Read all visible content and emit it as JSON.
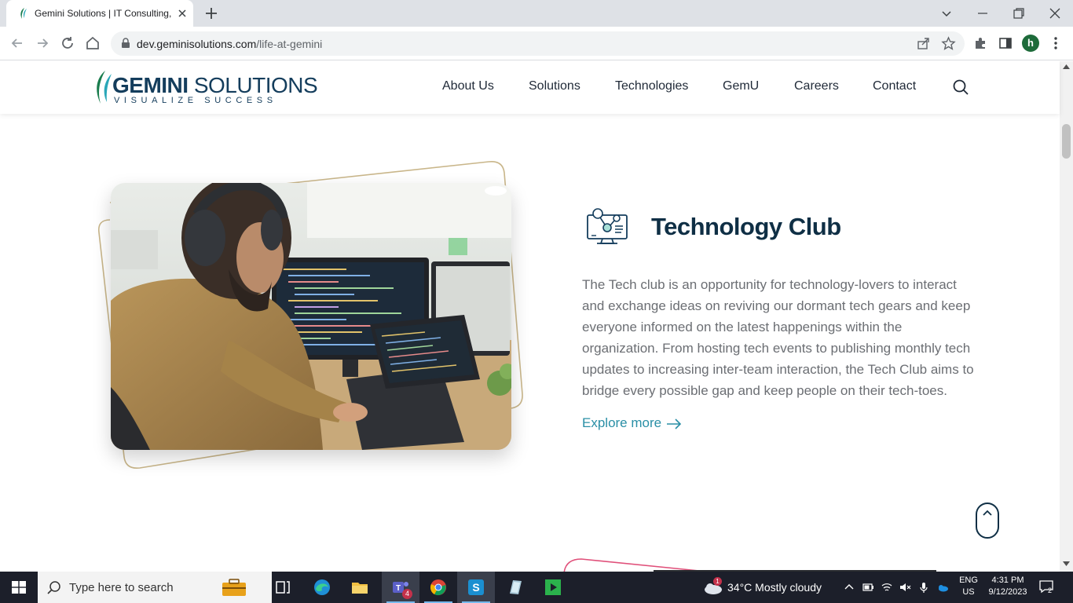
{
  "browser": {
    "tab_title": "Gemini Solutions | IT Consulting,",
    "url_host": "dev.geminisolutions.com",
    "url_path": "/life-at-gemini",
    "profile_initial": "h"
  },
  "site": {
    "logo_word_1": "GEMINI",
    "logo_word_2": " SOLUTIONS",
    "logo_tagline": "VISUALIZE SUCCESS",
    "nav": [
      "About Us",
      "Solutions",
      "Technologies",
      "GemU",
      "Careers",
      "Contact"
    ]
  },
  "section": {
    "title": "Technology Club",
    "description": "The Tech club is an opportunity for technology-lovers to interact and exchange ideas on reviving our dormant tech gears and keep everyone informed on the latest happenings within the organization. From hosting tech events to publishing monthly tech updates to increasing inter-team interaction, the Tech Club aims to bridge every possible gap and keep people on their tech-toes.",
    "link_label": "Explore more"
  },
  "taskbar": {
    "search_placeholder": "Type here to search",
    "teams_badge": "4",
    "weather_badge": "1",
    "weather": "34°C  Mostly cloudy",
    "lang_1": "ENG",
    "lang_2": "US",
    "time": "4:31 PM",
    "date": "9/12/2023",
    "notification_count": "2"
  },
  "colors": {
    "brand_navy": "#143d5c",
    "accent_teal": "#2a8fa6",
    "frame_gold": "#c9b68a",
    "taskbar_bg": "#1c1f2a"
  }
}
